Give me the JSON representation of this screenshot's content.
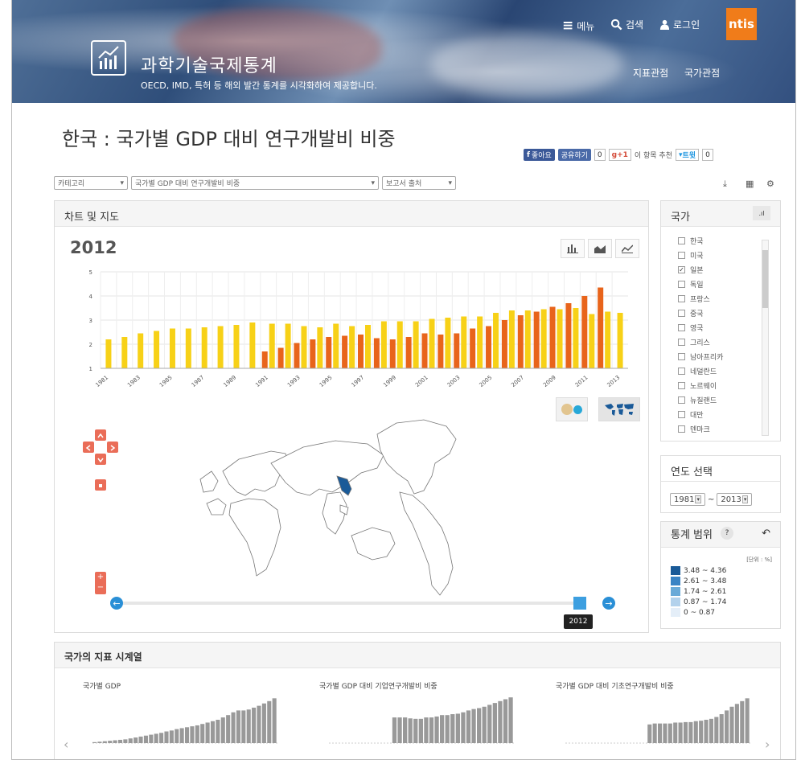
{
  "header": {
    "site_title": "과학기술국제통계",
    "site_subtitle": "OECD, IMD, 특허 등 해외 발간 통계를 시각화하여 제공합니다.",
    "menu_label": "메뉴",
    "search_label": "검색",
    "login_label": "로그인",
    "brand_logo": "ntis",
    "subnav": [
      "지표관점",
      "국가관점"
    ]
  },
  "page": {
    "title": "한국 : 국가별 GDP 대비 연구개발비 비중"
  },
  "share": {
    "like_label": "좋아요",
    "share_label": "공유하기",
    "like_count": "0",
    "gplus_label": "g+1",
    "gplus_text": "이 항목 추천",
    "tweet_label": "트윗",
    "tweet_count": "0"
  },
  "filters": {
    "category": "카테고리",
    "indicator": "국가별 GDP 대비 연구개발비 비중",
    "source": "보고서 출처"
  },
  "chart_panel": {
    "title": "차트 및 지도",
    "year": "2012",
    "slider_year": "2012"
  },
  "chart_data": {
    "type": "bar",
    "categories": [
      "1981",
      "1982",
      "1983",
      "1984",
      "1985",
      "1986",
      "1987",
      "1988",
      "1989",
      "1990",
      "1991",
      "1992",
      "1993",
      "1994",
      "1995",
      "1996",
      "1997",
      "1998",
      "1999",
      "2000",
      "2001",
      "2002",
      "2003",
      "2004",
      "2005",
      "2006",
      "2007",
      "2008",
      "2009",
      "2010",
      "2011",
      "2012",
      "2013"
    ],
    "tick_labels": [
      "1981",
      "1983",
      "1985",
      "1987",
      "1989",
      "1991",
      "1993",
      "1995",
      "1997",
      "1999",
      "2001",
      "2003",
      "2005",
      "2007",
      "2009",
      "2011",
      "2013"
    ],
    "series": [
      {
        "values": [
          2.2,
          2.3,
          2.45,
          2.55,
          2.65,
          2.65,
          2.7,
          2.75,
          2.8,
          2.9,
          2.85,
          2.85,
          2.75,
          2.7,
          2.85,
          2.75,
          2.8,
          2.95,
          2.95,
          2.95,
          3.05,
          3.1,
          3.15,
          3.15,
          3.3,
          3.4,
          3.4,
          3.45,
          3.45,
          3.5,
          3.25,
          3.35,
          3.3
        ],
        "color": "#f7d117"
      },
      {
        "values": [
          null,
          null,
          null,
          null,
          null,
          null,
          null,
          null,
          null,
          null,
          1.7,
          1.85,
          2.05,
          2.2,
          2.3,
          2.35,
          2.4,
          2.25,
          2.2,
          2.3,
          2.45,
          2.4,
          2.45,
          2.65,
          2.75,
          3.0,
          3.2,
          3.35,
          3.55,
          3.7,
          4.0,
          4.35,
          null
        ],
        "color": "#e8641b"
      }
    ],
    "ylim": [
      1,
      5
    ],
    "yticks": [
      "1",
      "2",
      "3",
      "4",
      "5"
    ]
  },
  "country_panel": {
    "title": "국가",
    "countries": [
      {
        "name": "한국",
        "checked": false
      },
      {
        "name": "미국",
        "checked": false
      },
      {
        "name": "일본",
        "checked": true
      },
      {
        "name": "독일",
        "checked": false
      },
      {
        "name": "프랑스",
        "checked": false
      },
      {
        "name": "중국",
        "checked": false
      },
      {
        "name": "영국",
        "checked": false
      },
      {
        "name": "그리스",
        "checked": false
      },
      {
        "name": "남아프리카",
        "checked": false
      },
      {
        "name": "네덜란드",
        "checked": false
      },
      {
        "name": "노르웨이",
        "checked": false
      },
      {
        "name": "뉴질랜드",
        "checked": false
      },
      {
        "name": "대만",
        "checked": false
      },
      {
        "name": "덴마크",
        "checked": false
      }
    ]
  },
  "year_panel": {
    "title": "연도 선택",
    "from": "1981",
    "separator": "~",
    "to": "2013"
  },
  "range_panel": {
    "title": "통계 범위",
    "help": "?",
    "unit": "[단위 : %]",
    "ranges": [
      {
        "label": "3.48  ~ 4.36",
        "color": "#1a5a98"
      },
      {
        "label": "2.61  ~ 3.48",
        "color": "#3a83c4"
      },
      {
        "label": "1.74  ~ 2.61",
        "color": "#6aaad8"
      },
      {
        "label": "0.87  ~ 1.74",
        "color": "#b3d2ec"
      },
      {
        "label": "0  ~ 0.87",
        "color": "#e4eef8"
      }
    ]
  },
  "timeseries": {
    "title": "국가의 지표 시계열",
    "charts": [
      {
        "title": "국가별 GDP",
        "values": [
          0.02,
          0.03,
          0.04,
          0.05,
          0.06,
          0.07,
          0.08,
          0.1,
          0.12,
          0.14,
          0.16,
          0.18,
          0.2,
          0.22,
          0.25,
          0.27,
          0.3,
          0.32,
          0.34,
          0.36,
          0.38,
          0.41,
          0.44,
          0.47,
          0.5,
          0.55,
          0.6,
          0.66,
          0.7,
          0.7,
          0.72,
          0.76,
          0.8,
          0.85,
          0.9,
          0.96
        ]
      },
      {
        "title": "국가별 GDP 대비 기업연구개발비 비중",
        "values": [
          null,
          null,
          null,
          null,
          null,
          null,
          null,
          null,
          null,
          null,
          null,
          null,
          0.55,
          0.55,
          0.55,
          0.53,
          0.52,
          0.52,
          0.55,
          0.55,
          0.57,
          0.6,
          0.6,
          0.62,
          0.63,
          0.66,
          0.7,
          0.73,
          0.75,
          0.78,
          0.82,
          0.86,
          0.9,
          0.94,
          0.98
        ]
      },
      {
        "title": "국가별 GDP 대비 기초연구개발비 비중",
        "values": [
          null,
          null,
          null,
          null,
          null,
          null,
          null,
          null,
          null,
          null,
          null,
          null,
          null,
          null,
          null,
          null,
          0.4,
          0.42,
          0.42,
          0.42,
          0.42,
          0.44,
          0.44,
          0.45,
          0.45,
          0.47,
          0.48,
          0.5,
          0.52,
          0.56,
          0.62,
          0.7,
          0.78,
          0.84,
          0.9,
          0.96
        ]
      }
    ]
  }
}
